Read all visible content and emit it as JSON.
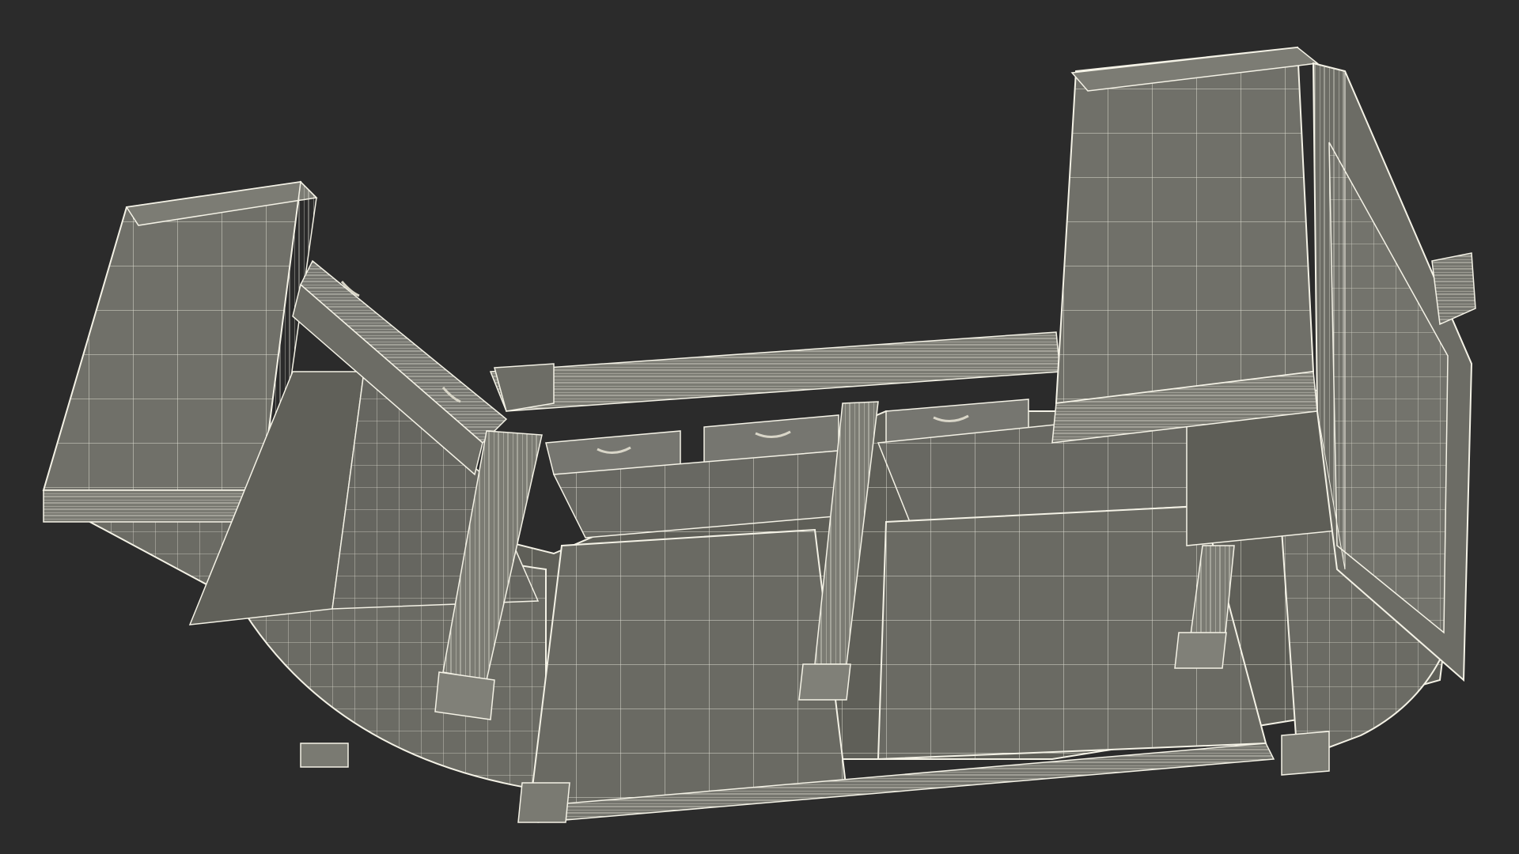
{
  "scene": {
    "subject": "wireframe-3d-model",
    "background_color": "#2b2b2b",
    "surface_color": "#6e6e66",
    "surface_dark_color": "#5d5d56",
    "surface_light_color": "#7a7a72",
    "wire_color": "#f4f2e6",
    "handle_color": "#d9d6c8",
    "drawer_handles": 5,
    "columns": 3
  }
}
